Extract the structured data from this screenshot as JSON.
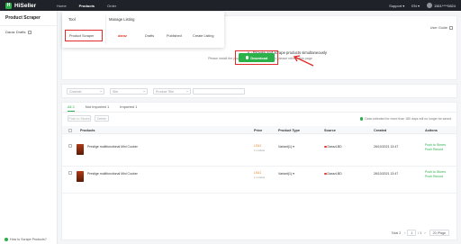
{
  "topbar": {
    "logo_mark": "H",
    "logo_text": "HiSeller",
    "nav": [
      "Home",
      "Products",
      "Order"
    ],
    "support": "Support ▾",
    "lang": "EN ▾",
    "user": "1561****0824"
  },
  "sidebar": {
    "title": "Product Scraper",
    "items": [
      {
        "label": "Daraz Drafts"
      }
    ],
    "help": "How to Scrape Products?"
  },
  "dropdown": {
    "col1_title": "Tool",
    "col2_title": "Manage Listing",
    "tool_item": "Product Scraper",
    "items": [
      "daraz",
      "Drafts",
      "Published",
      "Create Listing"
    ]
  },
  "banner": {
    "user_guide": "User Guide",
    "line1": "e - Browse and scrape products simultaneously",
    "line2": "Please install the plugin first. If already installed, please refresh this page",
    "download": "Download"
  },
  "filters": {
    "shop": "Channel",
    "site": "Site",
    "field": "Product Title"
  },
  "listing": {
    "tabs": [
      "All 2",
      "Not Imported 1",
      "Imported 1"
    ],
    "bulk": [
      "Push to Stores",
      "Delete"
    ],
    "notice": "Data collected for more than 180 days will no longer be saved",
    "columns": [
      "Products",
      "Price",
      "Product Type",
      "Source",
      "Created",
      "Actions"
    ],
    "rows": [
      {
        "title": "Prestige multifunctional Mini Cooker",
        "price": "LS41",
        "price_sub": "1 models",
        "type": "Variant(1) ▾",
        "source": "DarazLBD",
        "created": "26/10/2021 13:47",
        "action1": "Push to Stores",
        "action2": "Push Record"
      },
      {
        "title": "Prestige multifunctional Mini Cooker",
        "price": "LS41",
        "price_sub": "1 models",
        "type": "Variant(1) ▾",
        "source": "DarazLBD",
        "created": "26/10/2021 13:47",
        "action1": "Push to Stores",
        "action2": "Push Record"
      }
    ],
    "pager": {
      "total": "Total 2",
      "page": "1",
      "of": "/ 1",
      "per_page": "20 /Page"
    }
  },
  "colors": {
    "accent": "#2bb04a",
    "annotation": "#e02b2b",
    "topbar": "#1f2228"
  }
}
